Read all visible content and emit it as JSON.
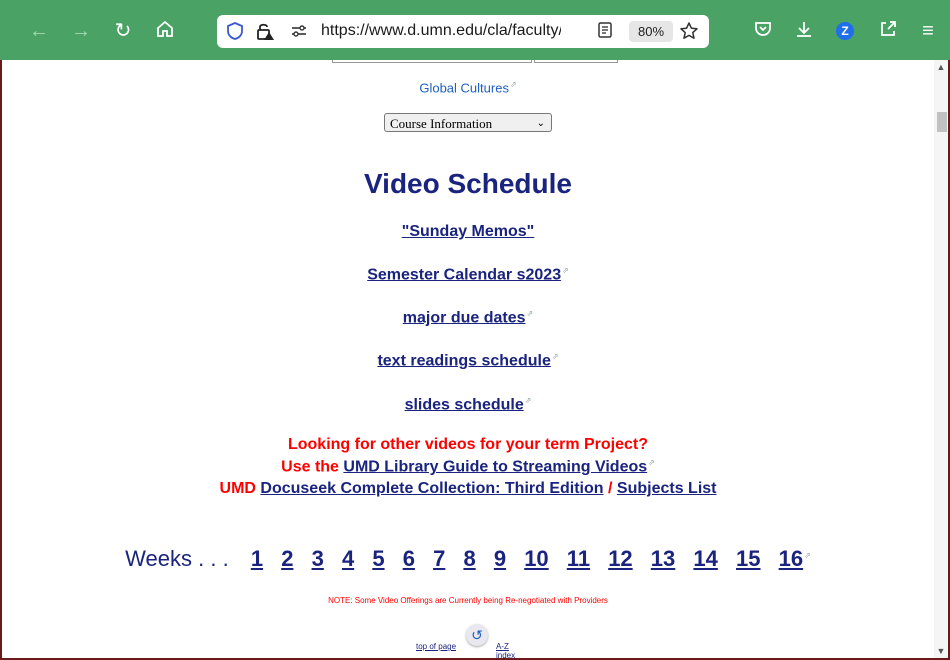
{
  "browser": {
    "back_icon": "arrow-left-icon",
    "forward_icon": "arrow-right-icon",
    "url": "https://www.d.umn.edu/cla/faculty/tr",
    "zoom": "80%",
    "accent": "#4aa264"
  },
  "page": {
    "global_cultures": "Global Cultures",
    "course_select": "Course Information",
    "title": "Video Schedule",
    "links": [
      "\"Sunday Memos\"",
      "Semester Calendar s2023",
      "major due dates",
      "text readings schedule",
      "slides schedule"
    ],
    "looking": "Looking for other videos for your term Project?",
    "use_the": "Use the",
    "library_guide": "UMD Library Guide to Streaming Videos",
    "umd": "UMD",
    "docuseek": "Docuseek Complete Collection: Third Edition",
    "slash": "/",
    "subjects": "Subjects List",
    "weeks_label": "Weeks . . .",
    "weeks": [
      "1",
      "2",
      "3",
      "4",
      "5",
      "6",
      "7",
      "8",
      "9",
      "10",
      "11",
      "12",
      "13",
      "14",
      "15",
      "16"
    ],
    "note": "NOTE: Some Video Offerings are Currently being Re-negotiated with Providers",
    "top_of_page": "top of page",
    "az_index": "A-Z index"
  }
}
